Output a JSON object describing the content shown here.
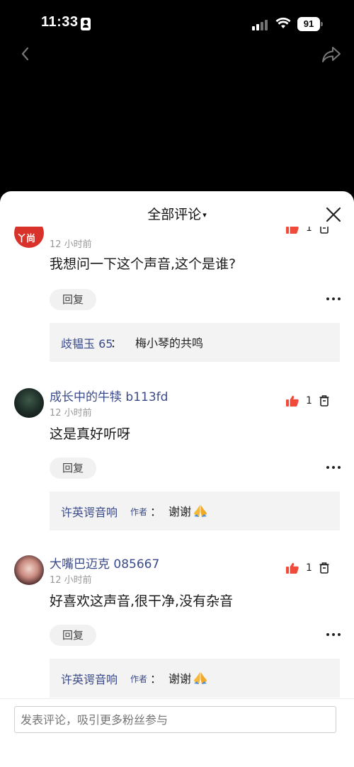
{
  "status_bar": {
    "time": "11:33",
    "battery": "91"
  },
  "header": {
    "title": "全部评论",
    "caret": "▾"
  },
  "comments": [
    {
      "username": "",
      "avatar_text": "丫尚",
      "time": "12 小时前",
      "likes": "1",
      "text": "我想问一下这个声音,这个是谁?",
      "reply_label": "回复",
      "sub_reply": {
        "user": "歧韫玉 65",
        "separator": "：",
        "author_tag": "",
        "text": "梅小琴的共鸣"
      }
    },
    {
      "username": "成长中的牛犊 b113fd",
      "time": "12 小时前",
      "likes": "1",
      "text": "这是真好听呀",
      "reply_label": "回复",
      "sub_reply": {
        "user": "许英谔音响",
        "author_tag": "作者",
        "separator": "：",
        "text": "谢谢"
      }
    },
    {
      "username": "大嘴巴迈克 085667",
      "time": "12 小时前",
      "likes": "1",
      "text": "好喜欢这声音,很干净,没有杂音",
      "reply_label": "回复",
      "sub_reply": {
        "user": "许英谔音响",
        "author_tag": "作者",
        "separator": "：",
        "text": "谢谢"
      }
    }
  ],
  "composer": {
    "placeholder": "发表评论，吸引更多粉丝参与"
  },
  "colors": {
    "like_red": "#f04a3a",
    "name_blue": "#3a4a8a",
    "sheet_bg": "#ffffff",
    "top_bg": "#000000"
  },
  "icons": [
    "id-card-icon",
    "signal-icon",
    "wifi-icon",
    "battery-icon",
    "back-icon",
    "share-icon",
    "close-icon",
    "thumbs-up-icon",
    "trash-icon",
    "more-icon",
    "pray-emoji"
  ]
}
